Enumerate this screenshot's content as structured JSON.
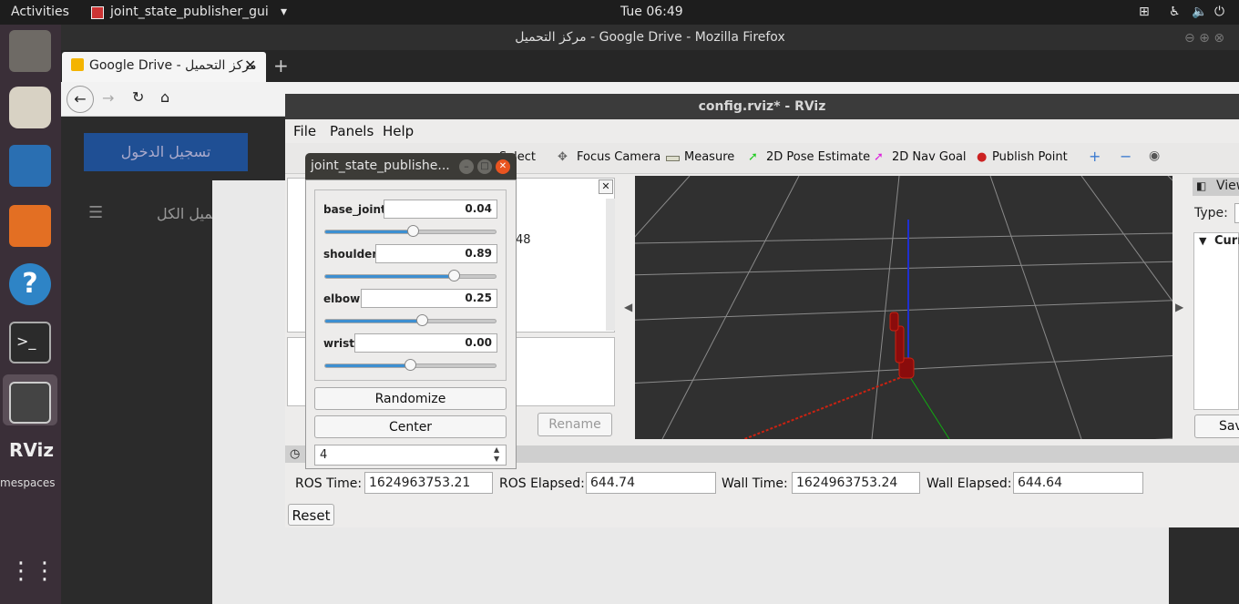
{
  "topbar": {
    "activities": "Activities",
    "app_name": "joint_state_publisher_gui",
    "clock": "Tue 06:49"
  },
  "firefox": {
    "window_title": "مركز التحميل - Google Drive - Mozilla Firefox",
    "tab_title": "مركز التحميل - Google Drive",
    "page_login": "تسجيل الدخول",
    "page_tab": "تحميل الكل",
    "page_rename": "Rename"
  },
  "rviz": {
    "window_title": "config.rviz* - RViz",
    "menu": [
      "File",
      "Panels",
      "Help"
    ],
    "tools": [
      "Select",
      "Focus Camera",
      "Measure",
      "2D Pose Estimate",
      "2D Nav Goal",
      "Publish Point"
    ],
    "left_value": "48",
    "views_title": "Views",
    "type_label": "Type:",
    "current_label": "Curr",
    "save_label": "Sav",
    "rename_label": "Rename",
    "time": {
      "ros_time_label": "ROS Time:",
      "ros_time": "1624963753.21",
      "ros_elapsed_label": "ROS Elapsed:",
      "ros_elapsed": "644.74",
      "wall_time_label": "Wall Time:",
      "wall_time": "1624963753.24",
      "wall_elapsed_label": "Wall Elapsed:",
      "wall_elapsed": "644.64",
      "reset_label": "Reset"
    }
  },
  "jsp": {
    "title": "joint_state_publishe...",
    "joints": [
      {
        "name": "base_joint",
        "value": "0.04",
        "fraction": 0.52
      },
      {
        "name": "shoulder",
        "value": "0.89",
        "fraction": 0.76
      },
      {
        "name": "elbow",
        "value": "0.25",
        "fraction": 0.57
      },
      {
        "name": "wrist",
        "value": "0.00",
        "fraction": 0.5
      }
    ],
    "randomize_label": "Randomize",
    "center_label": "Center",
    "spin_value": "4"
  },
  "dock": {
    "rviz_label": "RViz",
    "workspaces": "mespaces"
  }
}
